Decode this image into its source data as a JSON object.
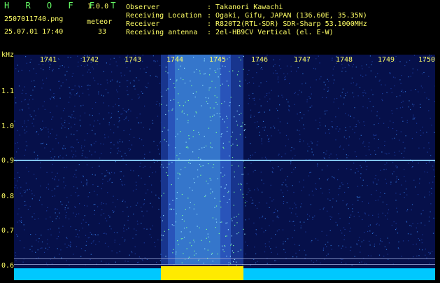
{
  "app": {
    "logo": "H R O F F T",
    "version": "1.0.0",
    "filename": "2507011740.png",
    "timestamp": "25.07.01 17:40",
    "meteor_label": "meteor",
    "meteor_count": "33"
  },
  "info": {
    "observer_label": "Observer",
    "observer_value": ": Takanori Kawachi",
    "location_label": "Receiving Location",
    "location_value": ": Ogaki, Gifu, JAPAN (136.60E, 35.35N)",
    "receiver_label": "Receiver",
    "receiver_value": ": R820T2(RTL-SDR) SDR-Sharp 53.1000MHz",
    "antenna_label": "Receiving antenna",
    "antenna_value": ": 2el-HB9CV Vertical (el. E-W)"
  },
  "axes": {
    "y_unit": "kHz",
    "x_ticks": [
      "1741",
      "1742",
      "1743",
      "1744",
      "1745",
      "1746",
      "1747",
      "1748",
      "1749",
      "1750"
    ],
    "y_ticks": [
      "1.1",
      "1.0",
      "0.9",
      "0.8",
      "0.7",
      "0.6"
    ]
  },
  "colors": {
    "text": "#ffff66",
    "accent": "#66ff66",
    "background": "#000000",
    "plot_bg": "#050a3a"
  }
}
